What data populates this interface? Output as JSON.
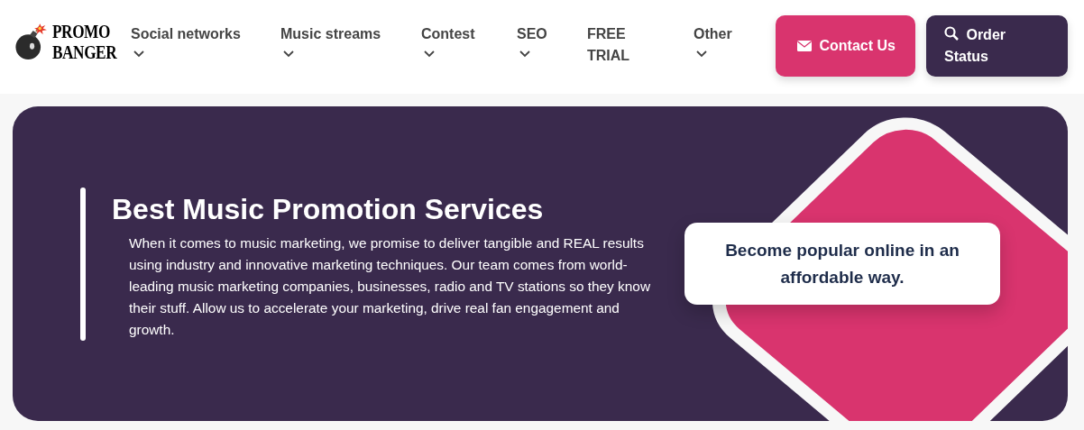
{
  "logo": {
    "lines": [
      "PROMO",
      "BANGER"
    ]
  },
  "nav": [
    {
      "label": "Social networks",
      "dropdown": true
    },
    {
      "label": "Music streams",
      "dropdown": true
    },
    {
      "label": "Contest",
      "dropdown": true
    },
    {
      "label": "SEO",
      "dropdown": true
    },
    {
      "label": "FREE TRIAL",
      "dropdown": false
    },
    {
      "label": "Other",
      "dropdown": true
    }
  ],
  "buttons": [
    {
      "label": "Contact Us",
      "kind": "contact"
    },
    {
      "label": "Order Status",
      "kind": "order"
    }
  ],
  "hero": {
    "title": "Best Music Promotion Services",
    "text": "When it comes to music marketing, we promise to deliver tangible and REAL results using industry and innovative marketing techniques. Our team comes from world-leading music marketing companies, businesses, radio and TV stations so they know their stuff. Allow us to accelerate your marketing, drive real fan engagement and growth.",
    "callout": "Become popular online in an affordable way."
  }
}
